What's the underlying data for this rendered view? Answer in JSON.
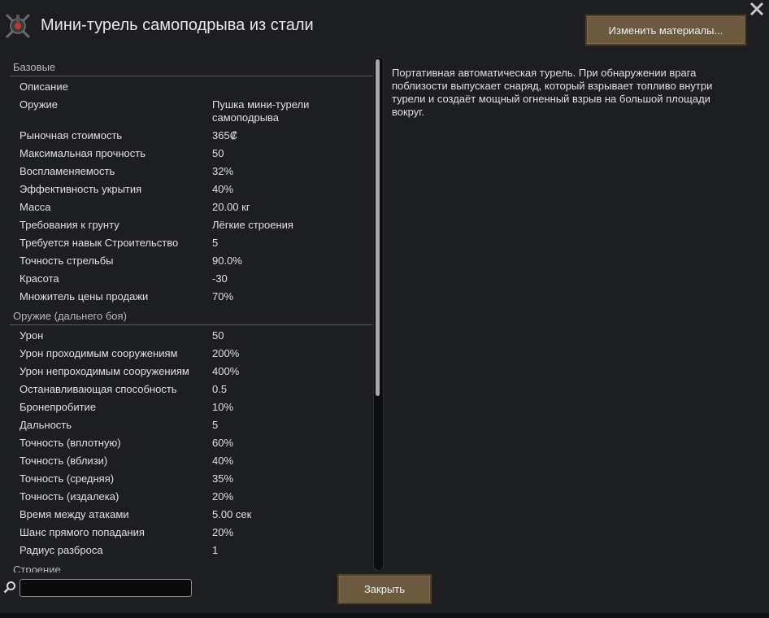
{
  "window": {
    "title": "Мини-турель самоподрыва из стали",
    "change_materials_label": "Изменить материалы...",
    "close_label": "Закрыть"
  },
  "sections": [
    {
      "header": "Базовые",
      "rows": [
        {
          "label": "Описание",
          "value": ""
        },
        {
          "label": "Оружие",
          "value": "Пушка мини-турели самоподрыва"
        },
        {
          "label": "Рыночная стоимость",
          "value": "365₡"
        },
        {
          "label": "Максимальная прочность",
          "value": "50"
        },
        {
          "label": "Воспламеняемость",
          "value": "32%"
        },
        {
          "label": "Эффективность укрытия",
          "value": "40%"
        },
        {
          "label": "Масса",
          "value": "20.00 кг"
        },
        {
          "label": "Требования к грунту",
          "value": "Лёгкие строения"
        },
        {
          "label": "Требуется навык Строительство",
          "value": "5"
        },
        {
          "label": "Точность стрельбы",
          "value": "90.0%"
        },
        {
          "label": "Красота",
          "value": "-30"
        },
        {
          "label": "Множитель цены продажи",
          "value": "70%"
        }
      ]
    },
    {
      "header": "Оружие (дальнего боя)",
      "rows": [
        {
          "label": "Урон",
          "value": "50"
        },
        {
          "label": "Урон проходимым сооружениям",
          "value": "200%"
        },
        {
          "label": "Урон непроходимым сооружениям",
          "value": "400%"
        },
        {
          "label": "Останавливающая способность",
          "value": "0.5"
        },
        {
          "label": "Бронепробитие",
          "value": "10%"
        },
        {
          "label": "Дальность",
          "value": "5"
        },
        {
          "label": "Точность (вплотную)",
          "value": "60%"
        },
        {
          "label": "Точность (вблизи)",
          "value": "40%"
        },
        {
          "label": "Точность (средняя)",
          "value": "35%"
        },
        {
          "label": "Точность (издалека)",
          "value": "20%"
        },
        {
          "label": "Время между атаками",
          "value": "5.00 сек"
        },
        {
          "label": "Шанс прямого попадания",
          "value": "20%"
        },
        {
          "label": "Радиус разброса",
          "value": "1"
        }
      ]
    },
    {
      "header": "Строение",
      "rows": []
    }
  ],
  "description": "Портативная автоматическая турель. При обнаружении врага поблизости выпускает снаряд, который взрывает топливо внутри турели и создаёт мощный огненный взрыв на большой площади вокруг.",
  "search": {
    "value": "",
    "icon": "magnifier-icon"
  },
  "icons": {
    "turret": "turret-icon",
    "close": "close-x-icon"
  },
  "colors": {
    "background": "#1c1e22",
    "button": "#6b5a3e",
    "text": "#e0e0e0",
    "section_header": "#b8b8b8"
  }
}
